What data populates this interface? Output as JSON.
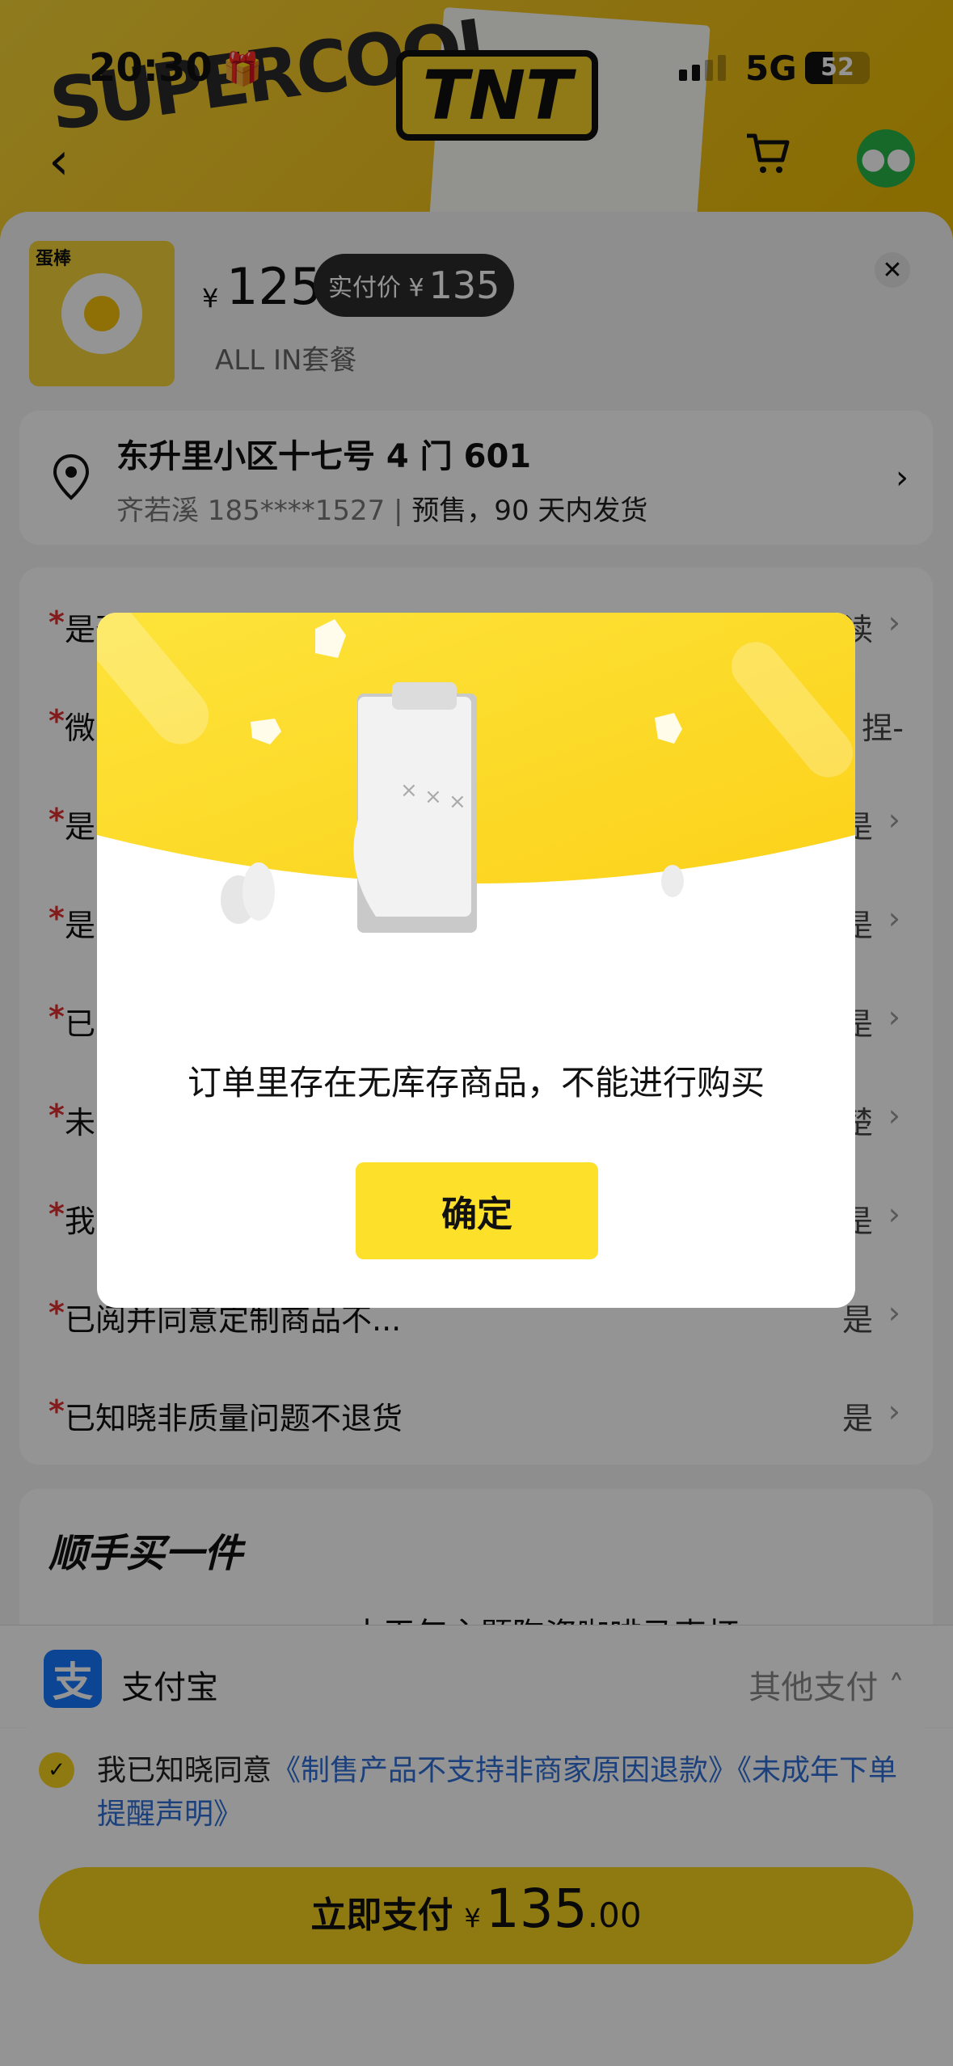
{
  "status_bar": {
    "time": "20:30",
    "network": "5G",
    "battery": "52"
  },
  "banner": {
    "left_text": "SUPERCOOL",
    "badge_text": "TNT"
  },
  "product": {
    "thumb_text": "蛋棒",
    "currency": "¥",
    "price": "125",
    "paid_label": "实付价 ¥",
    "paid_value": "135",
    "package": "ALL IN套餐"
  },
  "address": {
    "line1": "东升里小区十七号 4 门 601",
    "contact": "齐若溪 185****1527 |",
    "delivery": "预售，90 天内发货"
  },
  "questions": [
    {
      "label": "是否已阅读商品详情协议",
      "value": "已阅读"
    },
    {
      "label": "微",
      "value": "捏-"
    },
    {
      "label": "是",
      "value": "是"
    },
    {
      "label": "是",
      "value": "是"
    },
    {
      "label": "已",
      "value": "是"
    },
    {
      "label": "未",
      "value": "楚"
    },
    {
      "label": "我",
      "value": "是"
    },
    {
      "label": "已阅并同意定制商品不...",
      "value": "是"
    },
    {
      "label": "已知晓非质量问题不退货",
      "value": "是"
    }
  ],
  "extra": {
    "title": "顺手买一件",
    "item_text": "十平年主题陶瓷咖啡马克杯"
  },
  "payment": {
    "icon": "支",
    "method": "支付宝",
    "other": "其他支付"
  },
  "agreement": {
    "prefix": "我已知晓同意",
    "link1": "《制售产品不支持非商家原因退款》",
    "link2": "《未成年下单提醒声明》"
  },
  "pay_button": {
    "label": "立即支付",
    "currency": "¥",
    "amount": "135",
    "decimals": ".00"
  },
  "dialog": {
    "message": "订单里存在无库存商品，不能进行购买",
    "confirm": "确定"
  }
}
